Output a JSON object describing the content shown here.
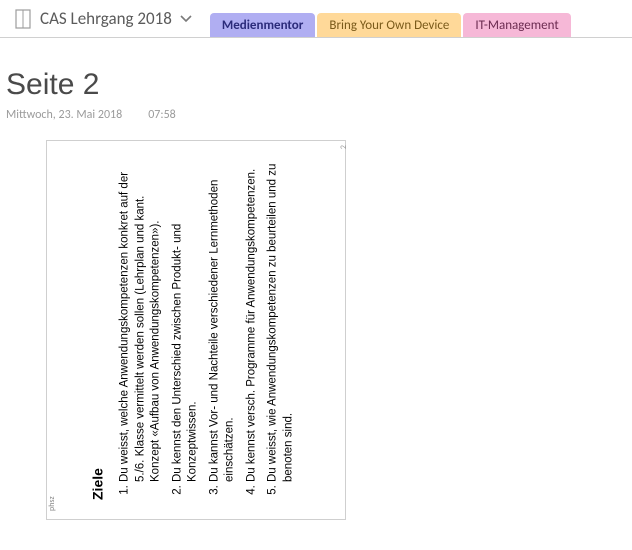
{
  "notebook": {
    "title": "CAS Lehrgang 2018"
  },
  "tabs": {
    "t0": "Medienmentor",
    "t1": "Bring Your Own Device",
    "t2": "IT-Management"
  },
  "page": {
    "title": "Seite 2",
    "date": "Mittwoch, 23. Mai 2018",
    "time": "07:58"
  },
  "embedded": {
    "heading": "Ziele",
    "page_num": "2",
    "footer": "phsz",
    "items": {
      "i1": "Du weisst, welche Anwendungskompetenzen konkret auf der 5./6. Klasse vermittelt werden sollen (Lehrplan und kant. Konzept «Aufbau von Anwendungskompetenzen»).",
      "i2": "Du kennst den Unterschied zwischen Produkt- und Konzeptwissen.",
      "i3": "Du kannst Vor- und Nachteile verschiedener Lernmethoden einschätzen.",
      "i4": "Du kennst versch. Programme für Anwendungskompetenzen.",
      "i5": "Du weisst, wie Anwendungskompetenzen zu beurteilen und zu benoten sind."
    }
  }
}
